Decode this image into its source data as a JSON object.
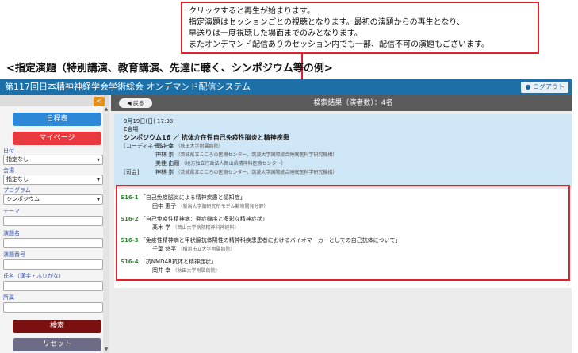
{
  "callout": {
    "lines": [
      "クリックすると再生が始まります。",
      "指定演題はセッションごとの視聴となります。最初の演題からの再生となり、",
      "早送りは一度視聴した場面までのみとなります。",
      "またオンデマンド配信ありのセッション内でも一部、配信不可の演題もございます。"
    ]
  },
  "heading": "<指定演題（特別講演、教育講演、先達に聴く、シンポジウム等の例>",
  "app": {
    "title": "第117回日本精神神経学会学術総会 オンデマンド配信システム",
    "logout": "ログアウト"
  },
  "sidebar": {
    "collapse": "<",
    "schedule_button": "日程表",
    "mypage_button": "マイページ",
    "fields": [
      {
        "label": "日付",
        "value": "指定なし",
        "type": "select"
      },
      {
        "label": "会場",
        "value": "指定なし",
        "type": "select"
      },
      {
        "label": "プログラム",
        "value": "シンポジウム",
        "type": "select"
      },
      {
        "label": "テーマ",
        "value": "",
        "type": "text"
      },
      {
        "label": "演題名",
        "value": "",
        "type": "text"
      },
      {
        "label": "演題番号",
        "value": "",
        "type": "text"
      },
      {
        "label": "氏名（漢字・ふりがな）",
        "value": "",
        "type": "text"
      },
      {
        "label": "所属",
        "value": "",
        "type": "text"
      }
    ],
    "search_button": "検索",
    "reset_button": "リセット"
  },
  "main": {
    "back_button": "戻る",
    "result_count": "検索結果（演者数）：4名",
    "session": {
      "datetime": "9月19日(日) 17:30",
      "room": "E会場",
      "title": "シンポジウム16 ／ 抗体介在性自己免疫性脳炎と精神疾患",
      "people": [
        {
          "role": "[コーディネーター]",
          "name": "岡井 幸",
          "aff": "（秋田大学附属病院）"
        },
        {
          "role": "",
          "name": "神林 崇",
          "aff": "（茨城県立こころの医療センター、筑波大学国際統合睡眠医科学研究機構）"
        },
        {
          "role": "",
          "name": "美佳 由剛",
          "aff": "（地方独立行政法人岡山県精神科医療センター）"
        },
        {
          "role": "[司会]",
          "name": "神林 崇",
          "aff": "（茨城県立こころの医療センター、筑波大学国際統合睡眠医科学研究機構）"
        }
      ]
    },
    "talks": [
      {
        "code": "S16-1",
        "title": "「自己免疫脳炎による精神疾患と認知症」",
        "speaker": "田中 恵子",
        "aff": "（新潟大学脳研究所モデル動物開発分野）"
      },
      {
        "code": "S16-2",
        "title": "「自己免疫性精神病：発症機序と多彩な精神症状」",
        "speaker": "髙木 学",
        "aff": "（岡山大学病院精神科神経科）"
      },
      {
        "code": "S16-3",
        "title": "「免疫性精神病と甲状腺抗体陽性の精神科疾患患者におけるバイオマーカーとしての自己抗体について」",
        "speaker": "千葉 悠平",
        "aff": "（横浜市立大学附属病院）"
      },
      {
        "code": "S16-4",
        "title": "「抗NMDAR抗体と精神症状」",
        "speaker": "岡井 幸",
        "aff": "（秋田大学附属病院）"
      }
    ]
  },
  "colors": {
    "title_bar": "#1d6fa8",
    "highlight_red": "#e0202a",
    "talk_code_green": "#2e8f2e",
    "session_bg": "#cfe6f7"
  }
}
